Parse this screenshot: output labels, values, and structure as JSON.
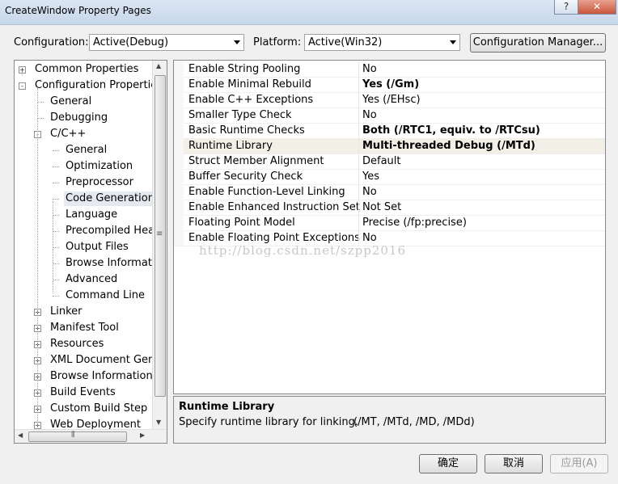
{
  "window": {
    "title": "CreateWindow Property Pages",
    "help_label": "?",
    "close_label": "✕"
  },
  "toolbar": {
    "configuration_label": "Configuration:",
    "configuration_value": "Active(Debug)",
    "platform_label": "Platform:",
    "platform_value": "Active(Win32)",
    "config_manager_label": "Configuration Manager..."
  },
  "tree": {
    "items": [
      {
        "label": "Common Properties"
      },
      {
        "label": "Configuration Properties"
      },
      {
        "label": "General"
      },
      {
        "label": "Debugging"
      },
      {
        "label": "C/C++"
      },
      {
        "label": "General"
      },
      {
        "label": "Optimization"
      },
      {
        "label": "Preprocessor"
      },
      {
        "label": "Code Generation"
      },
      {
        "label": "Language"
      },
      {
        "label": "Precompiled Head"
      },
      {
        "label": "Output Files"
      },
      {
        "label": "Browse Informatio"
      },
      {
        "label": "Advanced"
      },
      {
        "label": "Command Line"
      },
      {
        "label": "Linker"
      },
      {
        "label": "Manifest Tool"
      },
      {
        "label": "Resources"
      },
      {
        "label": "XML Document Gene"
      },
      {
        "label": "Browse Information"
      },
      {
        "label": "Build Events"
      },
      {
        "label": "Custom Build Step"
      },
      {
        "label": "Web Deployment"
      }
    ],
    "scroll_grip": "≡",
    "hscroll_grip": "⦀",
    "scroll_up": "▲",
    "scroll_down": "▼",
    "scroll_left": "◀",
    "scroll_right": "▶"
  },
  "properties": [
    {
      "name": "Enable String Pooling",
      "value": "No"
    },
    {
      "name": "Enable Minimal Rebuild",
      "value": "Yes (/Gm)"
    },
    {
      "name": "Enable C++ Exceptions",
      "value": "Yes (/EHsc)"
    },
    {
      "name": "Smaller Type Check",
      "value": "No"
    },
    {
      "name": "Basic Runtime Checks",
      "value": "Both (/RTC1, equiv. to /RTCsu)"
    },
    {
      "name": "Runtime Library",
      "value": "Multi-threaded Debug (/MTd)"
    },
    {
      "name": "Struct Member Alignment",
      "value": "Default"
    },
    {
      "name": "Buffer Security Check",
      "value": "Yes"
    },
    {
      "name": "Enable Function-Level Linking",
      "value": "No"
    },
    {
      "name": "Enable Enhanced Instruction Set",
      "value": "Not Set"
    },
    {
      "name": "Floating Point Model",
      "value": "Precise (/fp:precise)"
    },
    {
      "name": "Enable Floating Point Exceptions",
      "value": "No"
    }
  ],
  "description": {
    "title": "Runtime Library",
    "text": "Specify runtime library for linking.",
    "options": "(/MT, /MTd, /MD, /MDd)"
  },
  "watermark": "http://blog.csdn.net/szpp2016",
  "buttons": {
    "ok": "确定",
    "cancel": "取消",
    "apply": "应用(A)"
  }
}
